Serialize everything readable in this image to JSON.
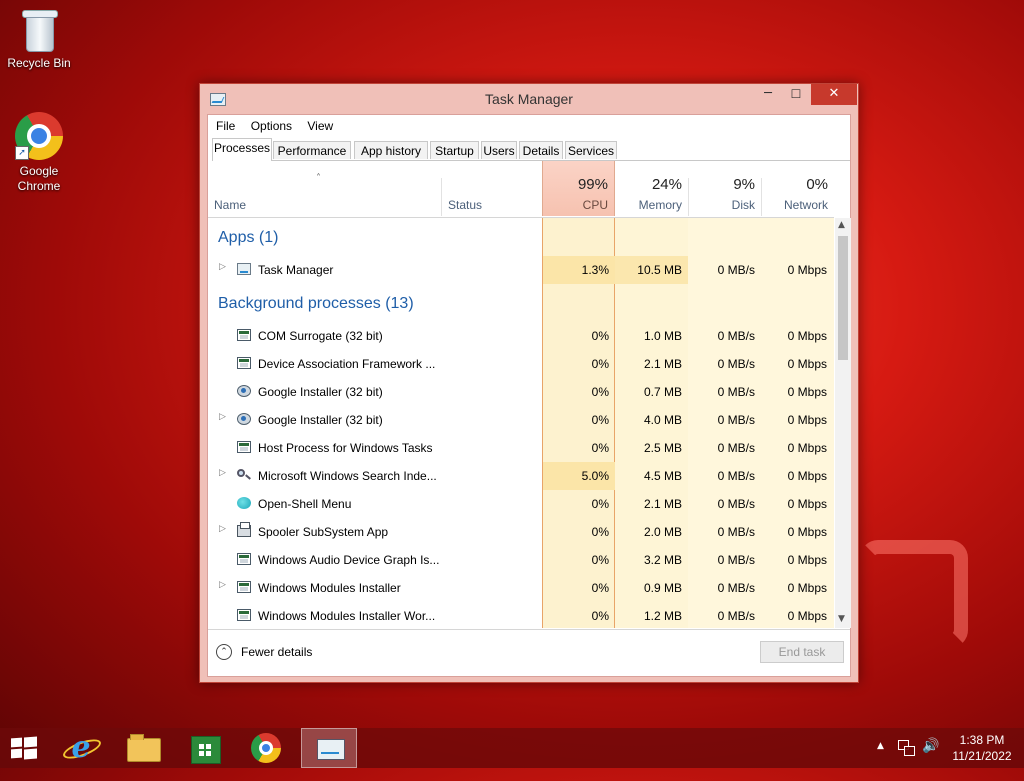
{
  "desktop": {
    "icons": [
      {
        "label": "Recycle Bin",
        "icon": "recycle-bin-icon"
      },
      {
        "label": "Google Chrome",
        "icon": "chrome-icon"
      }
    ]
  },
  "window": {
    "title": "Task Manager",
    "controls": {
      "minimize": "─",
      "maximize": "☐",
      "close": "✕"
    },
    "menu": [
      "File",
      "Options",
      "View"
    ],
    "tabs": [
      "Processes",
      "Performance",
      "App history",
      "Startup",
      "Users",
      "Details",
      "Services"
    ],
    "active_tab": "Processes",
    "columns": {
      "name": "Name",
      "status": "Status",
      "cpu": {
        "pct": "99%",
        "label": "CPU"
      },
      "memory": {
        "pct": "24%",
        "label": "Memory"
      },
      "disk": {
        "pct": "9%",
        "label": "Disk"
      },
      "network": {
        "pct": "0%",
        "label": "Network"
      },
      "sort_indicator": "˄"
    },
    "groups": {
      "apps": "Apps (1)",
      "background": "Background processes (13)"
    },
    "apps": [
      {
        "name": "Task Manager",
        "cpu": "1.3%",
        "memory": "10.5 MB",
        "disk": "0 MB/s",
        "network": "0 Mbps",
        "expandable": true,
        "icon": "task-manager-icon"
      }
    ],
    "background": [
      {
        "name": "COM Surrogate (32 bit)",
        "cpu": "0%",
        "memory": "1.0 MB",
        "disk": "0 MB/s",
        "network": "0 Mbps",
        "expandable": false,
        "icon": "window-icon"
      },
      {
        "name": "Device Association Framework ...",
        "cpu": "0%",
        "memory": "2.1 MB",
        "disk": "0 MB/s",
        "network": "0 Mbps",
        "expandable": false,
        "icon": "window-icon"
      },
      {
        "name": "Google Installer (32 bit)",
        "cpu": "0%",
        "memory": "0.7 MB",
        "disk": "0 MB/s",
        "network": "0 Mbps",
        "expandable": false,
        "icon": "installer-icon"
      },
      {
        "name": "Google Installer (32 bit)",
        "cpu": "0%",
        "memory": "4.0 MB",
        "disk": "0 MB/s",
        "network": "0 Mbps",
        "expandable": true,
        "icon": "installer-icon"
      },
      {
        "name": "Host Process for Windows Tasks",
        "cpu": "0%",
        "memory": "2.5 MB",
        "disk": "0 MB/s",
        "network": "0 Mbps",
        "expandable": false,
        "icon": "window-icon"
      },
      {
        "name": "Microsoft Windows Search Inde...",
        "cpu": "5.0%",
        "memory": "4.5 MB",
        "disk": "0 MB/s",
        "network": "0 Mbps",
        "expandable": true,
        "icon": "search-icon"
      },
      {
        "name": "Open-Shell Menu",
        "cpu": "0%",
        "memory": "2.1 MB",
        "disk": "0 MB/s",
        "network": "0 Mbps",
        "expandable": false,
        "icon": "shell-icon"
      },
      {
        "name": "Spooler SubSystem App",
        "cpu": "0%",
        "memory": "2.0 MB",
        "disk": "0 MB/s",
        "network": "0 Mbps",
        "expandable": true,
        "icon": "printer-icon"
      },
      {
        "name": "Windows Audio Device Graph Is...",
        "cpu": "0%",
        "memory": "3.2 MB",
        "disk": "0 MB/s",
        "network": "0 Mbps",
        "expandable": false,
        "icon": "window-icon"
      },
      {
        "name": "Windows Modules Installer",
        "cpu": "0%",
        "memory": "0.9 MB",
        "disk": "0 MB/s",
        "network": "0 Mbps",
        "expandable": true,
        "icon": "window-icon"
      },
      {
        "name": "Windows Modules Installer Wor...",
        "cpu": "0%",
        "memory": "1.2 MB",
        "disk": "0 MB/s",
        "network": "0 Mbps",
        "expandable": false,
        "icon": "window-icon"
      }
    ],
    "footer": {
      "fewer_details": "Fewer details",
      "fewer_icon": "⌃",
      "end_task": "End task"
    }
  },
  "taskbar": {
    "pinned": [
      "start-button",
      "internet-explorer-icon",
      "file-explorer-icon",
      "store-icon",
      "chrome-icon",
      "task-manager-icon"
    ],
    "ie_glyph": "e",
    "tray": {
      "show_hidden": "▲",
      "volume": "🔊"
    },
    "clock": {
      "time": "1:38 PM",
      "date": "11/21/2022"
    }
  },
  "colors": {
    "accent_window": "#c7392c",
    "group_title": "#1f5ea8",
    "cpu_header": "#f6c2b0"
  }
}
